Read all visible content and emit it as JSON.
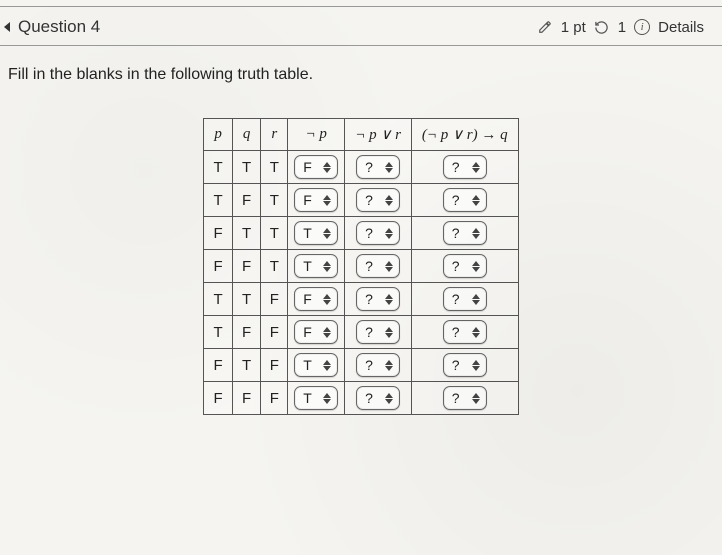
{
  "header": {
    "question_label": "Question 4",
    "points_text": "1 pt",
    "retry_text": "1",
    "details_label": "Details"
  },
  "prompt": "Fill in the blanks in the following truth table.",
  "columns": {
    "p": "p",
    "q": "q",
    "r": "r",
    "notp": "¬ p",
    "notp_or_r": "¬ p ∨ r",
    "implies": "(¬ p ∨ r) → q"
  },
  "rows": [
    {
      "p": "T",
      "q": "T",
      "r": "T",
      "notp": "F",
      "notp_or_r": "?",
      "implies": "?"
    },
    {
      "p": "T",
      "q": "F",
      "r": "T",
      "notp": "F",
      "notp_or_r": "?",
      "implies": "?"
    },
    {
      "p": "F",
      "q": "T",
      "r": "T",
      "notp": "T",
      "notp_or_r": "?",
      "implies": "?"
    },
    {
      "p": "F",
      "q": "F",
      "r": "T",
      "notp": "T",
      "notp_or_r": "?",
      "implies": "?"
    },
    {
      "p": "T",
      "q": "T",
      "r": "F",
      "notp": "F",
      "notp_or_r": "?",
      "implies": "?"
    },
    {
      "p": "T",
      "q": "F",
      "r": "F",
      "notp": "F",
      "notp_or_r": "?",
      "implies": "?"
    },
    {
      "p": "F",
      "q": "T",
      "r": "F",
      "notp": "T",
      "notp_or_r": "?",
      "implies": "?"
    },
    {
      "p": "F",
      "q": "F",
      "r": "F",
      "notp": "T",
      "notp_or_r": "?",
      "implies": "?"
    }
  ]
}
